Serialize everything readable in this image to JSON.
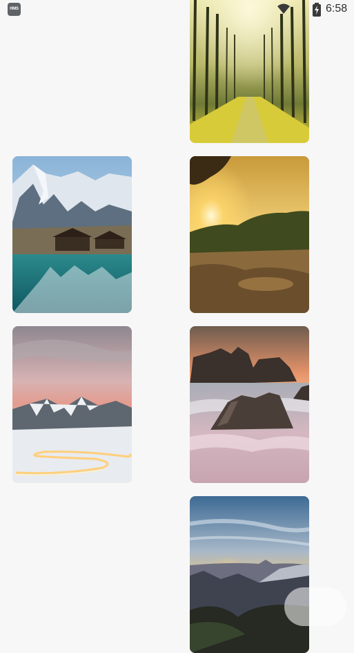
{
  "status_bar": {
    "left_badge": "HMS",
    "time": "6:58"
  },
  "wallpapers": [
    {
      "name": "forest-avenue"
    },
    {
      "name": "glacier-lake-cabin"
    },
    {
      "name": "rocky-sunset"
    },
    {
      "name": "snowy-road-light-trails"
    },
    {
      "name": "rocks-above-clouds"
    },
    {
      "name": "mountain-sunrise"
    }
  ]
}
